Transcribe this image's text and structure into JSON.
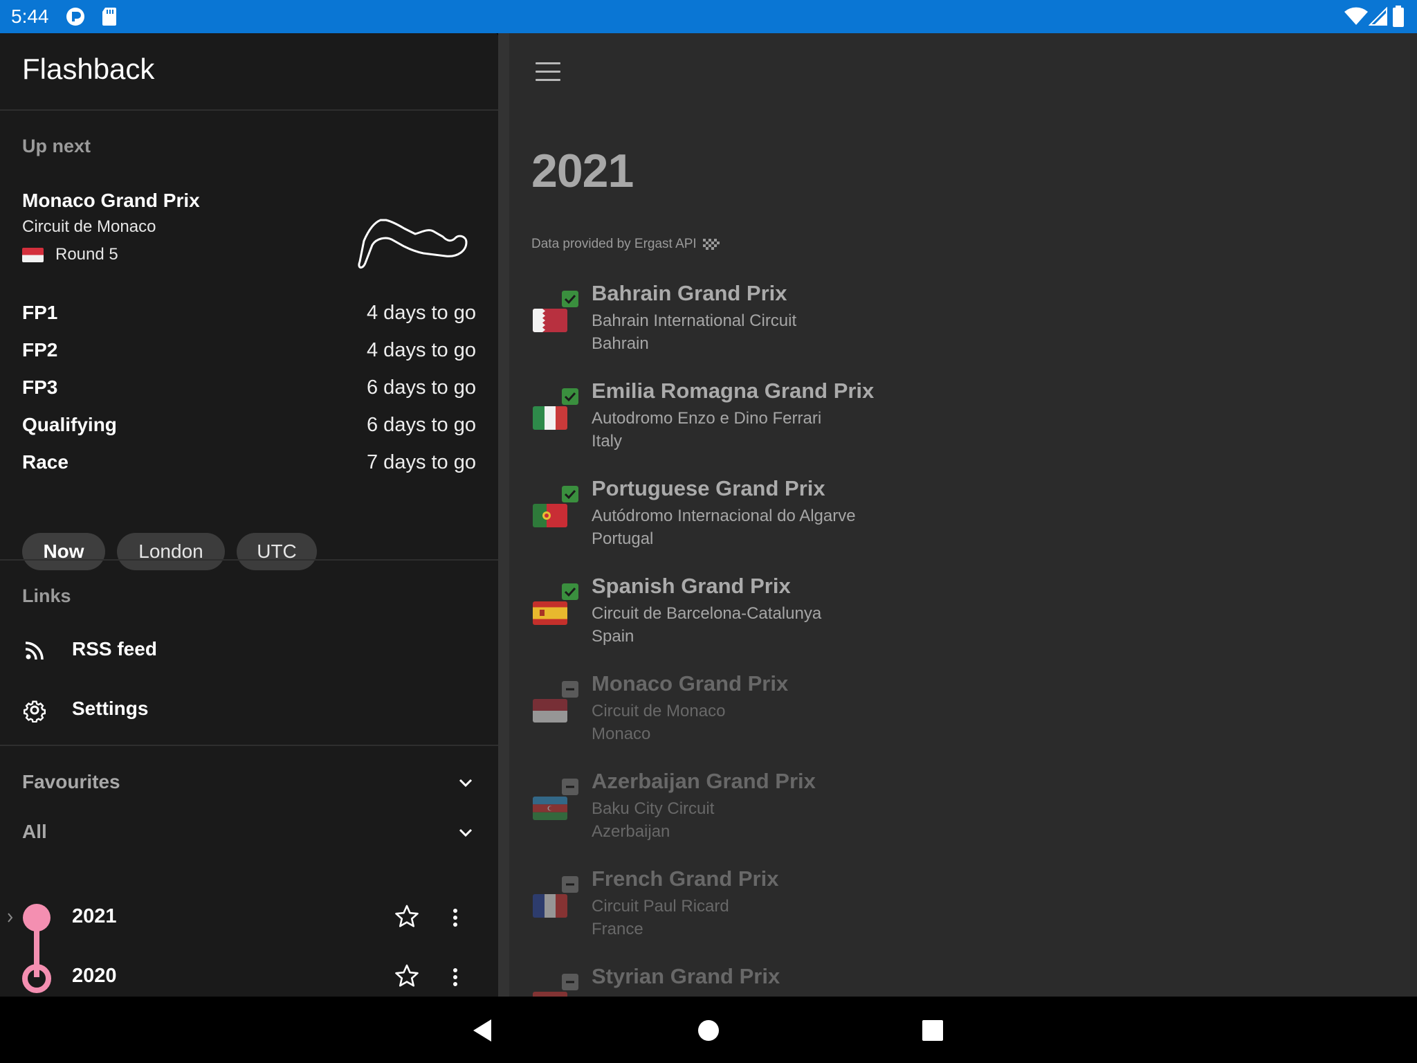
{
  "status_bar": {
    "time": "5:44",
    "bg_color": "#0a76d4",
    "icons": [
      "reader-icon",
      "sd-card-icon",
      "wifi-icon",
      "signal-icon",
      "battery-icon"
    ]
  },
  "drawer": {
    "app_title": "Flashback",
    "up_next": {
      "label": "Up next",
      "race_name": "Monaco Grand Prix",
      "circuit": "Circuit de Monaco",
      "round": "Round 5",
      "flag": "monaco-flag"
    },
    "sessions": [
      {
        "name": "FP1",
        "time": "4 days to go"
      },
      {
        "name": "FP2",
        "time": "4 days to go"
      },
      {
        "name": "FP3",
        "time": "6 days to go"
      },
      {
        "name": "Qualifying",
        "time": "6 days to go"
      },
      {
        "name": "Race",
        "time": "7 days to go"
      }
    ],
    "timezone_chips": [
      {
        "label": "Now",
        "selected": true
      },
      {
        "label": "London",
        "selected": false
      },
      {
        "label": "UTC",
        "selected": false
      }
    ],
    "links": {
      "label": "Links",
      "items": [
        {
          "label": "RSS feed",
          "icon": "rss-icon"
        },
        {
          "label": "Settings",
          "icon": "gear-icon"
        }
      ]
    },
    "favourites": {
      "label": "Favourites"
    },
    "all": {
      "label": "All"
    },
    "seasons": [
      {
        "year": "2021",
        "marker": "filled"
      },
      {
        "year": "2020",
        "marker": "ring"
      }
    ],
    "accent_color": "#f48fb1"
  },
  "main": {
    "season_title": "2021",
    "credit": "Data provided by Ergast API",
    "races": [
      {
        "name": "Bahrain Grand Prix",
        "circuit": "Bahrain International Circuit",
        "country": "Bahrain",
        "status": "completed",
        "flag": "bahrain"
      },
      {
        "name": "Emilia Romagna Grand Prix",
        "circuit": "Autodromo Enzo e Dino Ferrari",
        "country": "Italy",
        "status": "completed",
        "flag": "italy"
      },
      {
        "name": "Portuguese Grand Prix",
        "circuit": "Autódromo Internacional do Algarve",
        "country": "Portugal",
        "status": "completed",
        "flag": "portugal"
      },
      {
        "name": "Spanish Grand Prix",
        "circuit": "Circuit de Barcelona-Catalunya",
        "country": "Spain",
        "status": "completed",
        "flag": "spain"
      },
      {
        "name": "Monaco Grand Prix",
        "circuit": "Circuit de Monaco",
        "country": "Monaco",
        "status": "upcoming",
        "flag": "monaco"
      },
      {
        "name": "Azerbaijan Grand Prix",
        "circuit": "Baku City Circuit",
        "country": "Azerbaijan",
        "status": "upcoming",
        "flag": "azerbaijan"
      },
      {
        "name": "French Grand Prix",
        "circuit": "Circuit Paul Ricard",
        "country": "France",
        "status": "upcoming",
        "flag": "france"
      },
      {
        "name": "Styrian Grand Prix",
        "circuit": "",
        "country": "",
        "status": "upcoming",
        "flag": "austria"
      }
    ],
    "completed_color": "#3a8f3e",
    "upcoming_color": "#5a5a5a"
  },
  "nav_bar": {
    "buttons": [
      "back-icon",
      "home-icon",
      "recents-icon"
    ]
  }
}
